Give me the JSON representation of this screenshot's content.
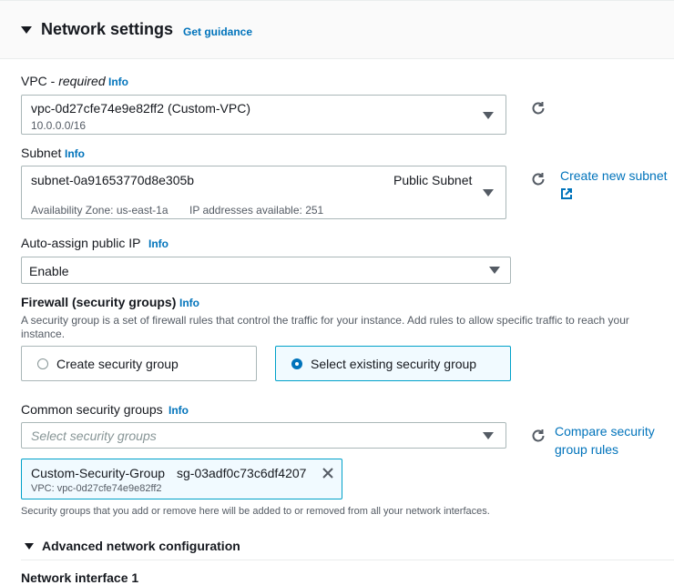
{
  "section": {
    "title": "Network settings",
    "guidance_link": "Get guidance"
  },
  "vpc": {
    "label": "VPC - ",
    "required": "required",
    "info": "Info",
    "value": "vpc-0d27cfe74e9e82ff2 (Custom-VPC)",
    "cidr": "10.0.0.0/16"
  },
  "subnet": {
    "label": "Subnet",
    "info": "Info",
    "value": "subnet-0a91653770d8e305b",
    "tag": "Public Subnet",
    "az": "Availability Zone: us-east-1a",
    "ips": "IP addresses available: 251",
    "create_link": "Create new subnet"
  },
  "public_ip": {
    "label": "Auto-assign public IP",
    "info": "Info",
    "value": "Enable"
  },
  "firewall": {
    "label": "Firewall (security groups)",
    "info": "Info",
    "description": "A security group is a set of firewall rules that control the traffic for your instance. Add rules to allow specific traffic to reach your instance.",
    "option_create": "Create security group",
    "option_select": "Select existing security group",
    "selected": "select"
  },
  "common_sg": {
    "label": "Common security groups",
    "info": "Info",
    "placeholder": "Select security groups",
    "compare_link_line1": "Compare security",
    "compare_link_line2": "group rules",
    "token_name": "Custom-Security-Group",
    "token_id": "sg-03adf0c73c6df4207",
    "token_vpc": "VPC: vpc-0d27cfe74e9e82ff2",
    "note": "Security groups that you add or remove here will be added to or removed from all your network interfaces."
  },
  "advanced": {
    "title": "Advanced network configuration",
    "next_heading": "Network interface 1"
  },
  "icons": {
    "refresh": "refresh-icon",
    "external": "external-link-icon",
    "remove": "close-icon",
    "caret": "caret-down-icon"
  },
  "colors": {
    "link": "#0073bb",
    "selected_border": "#00a1c9",
    "selected_bg": "#f1faff"
  }
}
